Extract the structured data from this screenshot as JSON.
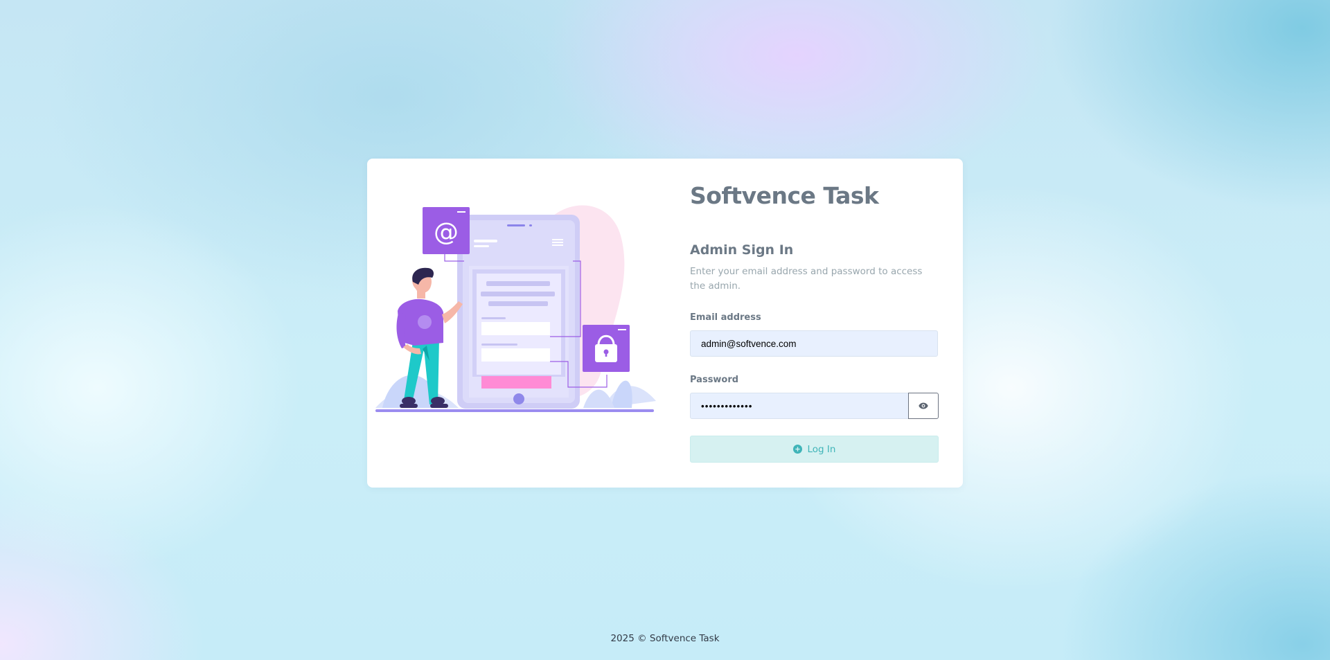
{
  "app": {
    "title": "Softvence Task"
  },
  "login": {
    "heading": "Admin Sign In",
    "description": "Enter your email address and password to access the admin.",
    "email_label": "Email address",
    "email_value": "admin@softvence.com",
    "password_label": "Password",
    "password_value": "adminpassword",
    "show_password_icon": "eye-icon",
    "submit_label": "Log In",
    "submit_icon": "plus-circle-icon"
  },
  "illustration": {
    "icon": "signin-illustration",
    "at_glyph": "@"
  },
  "footer": {
    "text": "2025 © Softvence Task"
  },
  "colors": {
    "accent_purple": "#9b5de5",
    "accent_teal": "#3fb4b8",
    "heading_gray": "#6b7885",
    "input_bg": "#e8f0fe",
    "button_bg": "#d6f1f1"
  }
}
